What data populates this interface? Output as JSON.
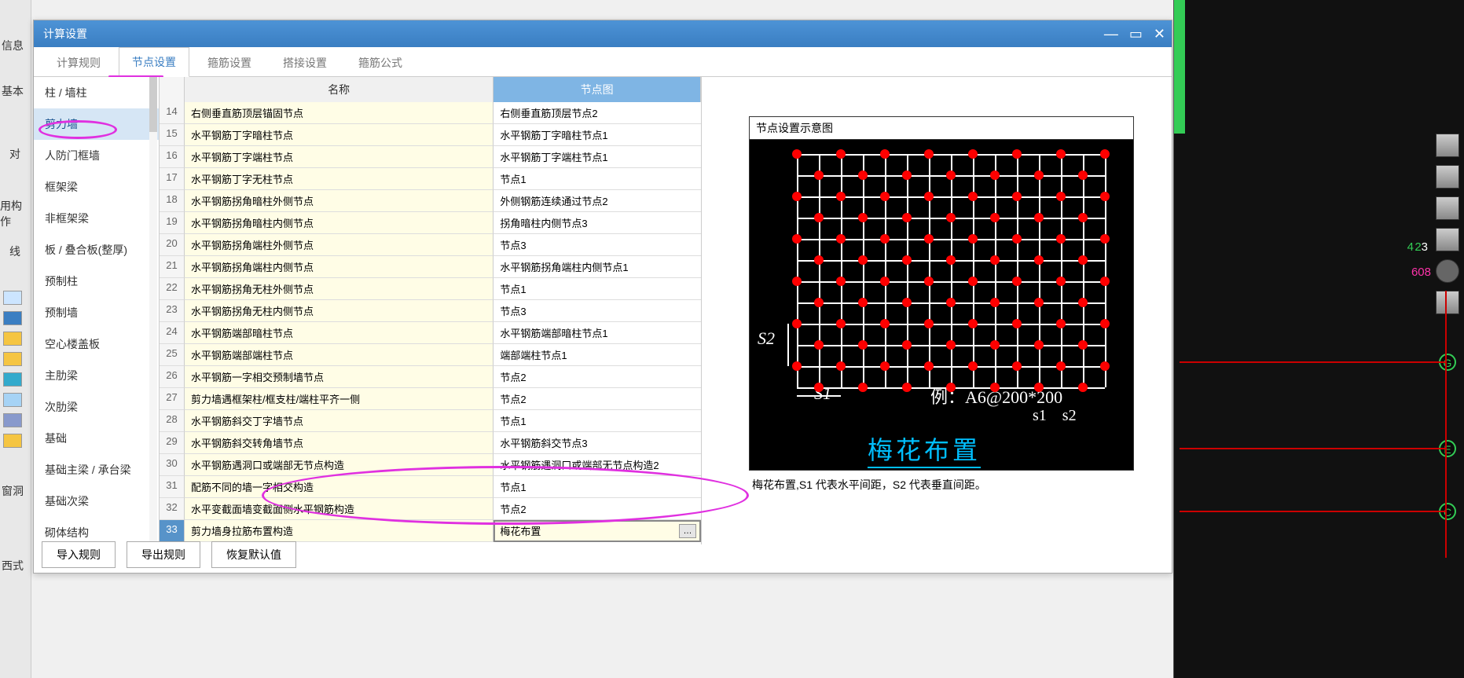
{
  "left_labels": [
    "信息",
    "基本",
    "对",
    "用构作",
    "线",
    "窗洞",
    "西式"
  ],
  "window_title": "计算设置",
  "tabs": [
    "计算规则",
    "节点设置",
    "箍筋设置",
    "搭接设置",
    "箍筋公式"
  ],
  "active_tab": 1,
  "side_items": [
    "柱 / 墙柱",
    "剪力墙",
    "人防门框墙",
    "框架梁",
    "非框架梁",
    "板 / 叠合板(整厚)",
    "预制柱",
    "预制墙",
    "空心楼盖板",
    "主肋梁",
    "次肋梁",
    "基础",
    "基础主梁 / 承台梁",
    "基础次梁",
    "砌体结构"
  ],
  "selected_side": 1,
  "table_headers": {
    "name": "名称",
    "node": "节点图"
  },
  "rows": [
    {
      "num": "14",
      "name": "右侧垂直筋顶层锚固节点",
      "node": "右侧垂直筋顶层节点2"
    },
    {
      "num": "15",
      "name": "水平钢筋丁字暗柱节点",
      "node": "水平钢筋丁字暗柱节点1"
    },
    {
      "num": "16",
      "name": "水平钢筋丁字端柱节点",
      "node": "水平钢筋丁字端柱节点1"
    },
    {
      "num": "17",
      "name": "水平钢筋丁字无柱节点",
      "node": "节点1"
    },
    {
      "num": "18",
      "name": "水平钢筋拐角暗柱外侧节点",
      "node": "外侧钢筋连续通过节点2"
    },
    {
      "num": "19",
      "name": "水平钢筋拐角暗柱内侧节点",
      "node": "拐角暗柱内侧节点3"
    },
    {
      "num": "20",
      "name": "水平钢筋拐角端柱外侧节点",
      "node": "节点3"
    },
    {
      "num": "21",
      "name": "水平钢筋拐角端柱内侧节点",
      "node": "水平钢筋拐角端柱内侧节点1"
    },
    {
      "num": "22",
      "name": "水平钢筋拐角无柱外侧节点",
      "node": "节点1"
    },
    {
      "num": "23",
      "name": "水平钢筋拐角无柱内侧节点",
      "node": "节点3"
    },
    {
      "num": "24",
      "name": "水平钢筋端部暗柱节点",
      "node": "水平钢筋端部暗柱节点1"
    },
    {
      "num": "25",
      "name": "水平钢筋端部端柱节点",
      "node": "端部端柱节点1"
    },
    {
      "num": "26",
      "name": "水平钢筋一字相交预制墙节点",
      "node": "节点2"
    },
    {
      "num": "27",
      "name": "剪力墙遇框架柱/框支柱/端柱平齐一侧",
      "node": "节点2"
    },
    {
      "num": "28",
      "name": "水平钢筋斜交丁字墙节点",
      "node": "节点1"
    },
    {
      "num": "29",
      "name": "水平钢筋斜交转角墙节点",
      "node": "水平钢筋斜交节点3"
    },
    {
      "num": "30",
      "name": "水平钢筋遇洞口或端部无节点构造",
      "node": "水平钢筋遇洞口或端部无节点构造2"
    },
    {
      "num": "31",
      "name": "配筋不同的墙一字相交构造",
      "node": "节点1"
    },
    {
      "num": "32",
      "name": "水平变截面墙变截面侧水平钢筋构造",
      "node": "节点2"
    },
    {
      "num": "33",
      "name": "剪力墙身拉筋布置构造",
      "node": "梅花布置",
      "selected": true
    }
  ],
  "preview": {
    "title": "节点设置示意图",
    "s1": "S1",
    "s2": "S2",
    "example": "例：A6@200*200",
    "s1s2": "s1 s2",
    "plum": "梅花布置",
    "desc": "梅花布置,S1 代表水平间距，S2 代表垂直间距。"
  },
  "footer": {
    "import": "导入规则",
    "export": "导出规则",
    "restore": "恢复默认值"
  },
  "rightbar": {
    "num23": "23",
    "num4": "4",
    "num608": "608",
    "letters": [
      "G",
      "E",
      "C"
    ]
  }
}
